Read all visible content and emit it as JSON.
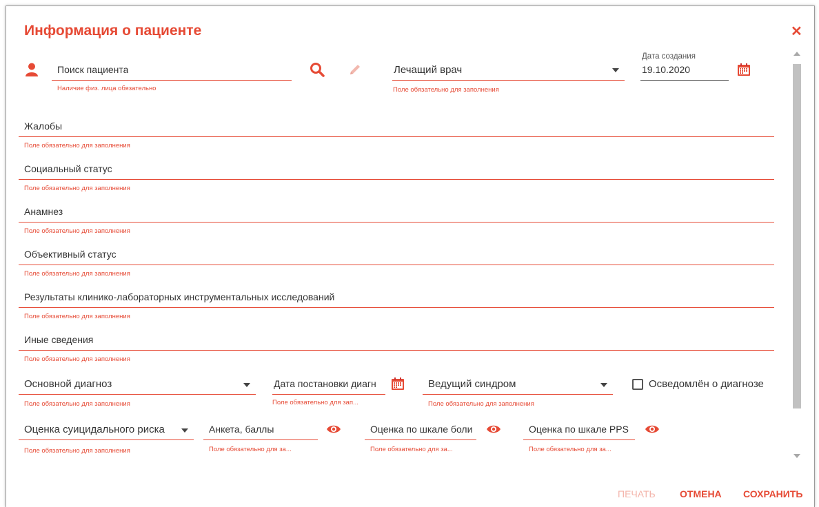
{
  "dialog": {
    "title": "Информация о пациенте",
    "close_icon": "close-icon"
  },
  "colors": {
    "accent": "#e64a35",
    "disabled": "#f3b4aa"
  },
  "patient": {
    "search_label": "Поиск пациента",
    "error": "Наличие физ. лица обязательно",
    "icons": [
      "person-icon",
      "search-icon",
      "pencil-icon"
    ]
  },
  "doctor": {
    "label": "Лечащий врач",
    "error": "Поле обязательно для заполнения"
  },
  "created": {
    "label": "Дата создания",
    "value": "19.10.2020",
    "icon": "calendar-icon"
  },
  "text_fields": [
    {
      "label": "Жалобы",
      "error": "Поле обязательно для заполнения"
    },
    {
      "label": "Социальный статус",
      "error": "Поле обязательно для заполнения"
    },
    {
      "label": "Анамнез",
      "error": "Поле обязательно для заполнения"
    },
    {
      "label": "Объективный статус",
      "error": "Поле обязательно для заполнения"
    },
    {
      "label": "Результаты клинико-лабораторных инструментальных исследований",
      "error": "Поле обязательно для заполнения"
    },
    {
      "label": "Иные сведения",
      "error": "Поле обязательно для заполнения"
    }
  ],
  "diagnosis": {
    "main_label": "Основной диагноз",
    "main_error": "Поле обязательно для заполнения",
    "date_label": "Дата постановки диагн",
    "date_error": "Поле обязательно для зап...",
    "syndrome_label": "Ведущий синдром",
    "syndrome_error": "Поле обязательно для заполнения",
    "informed_label": "Осведомлён о диагнозе",
    "informed_checked": false
  },
  "assessment": {
    "suicide_label": "Оценка суицидального риска",
    "suicide_error": "Поле обязательно для заполнения",
    "survey_label": "Анкета, баллы",
    "survey_error": "Поле обязательно для за...",
    "pain_label": "Оценка по шкале боли",
    "pain_error": "Поле обязательно для за...",
    "pps_label": "Оценка по шкале PPS",
    "pps_error": "Поле обязательно для за...",
    "icon": "eye-icon"
  },
  "footer": {
    "print": "ПЕЧАТЬ",
    "cancel": "ОТМЕНА",
    "save": "СОХРАНИТЬ"
  }
}
